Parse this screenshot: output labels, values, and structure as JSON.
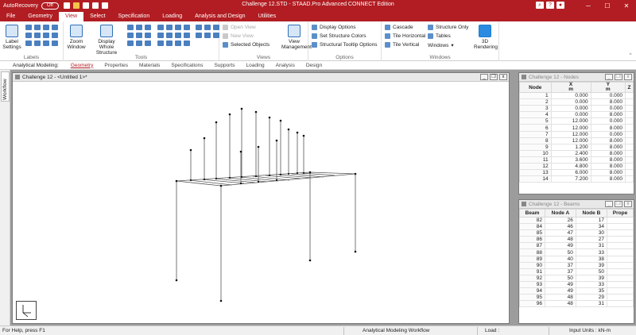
{
  "titlebar": {
    "autorecovery": "AutoRecovery",
    "autorecovery_state": "Off",
    "title": "Challenge 12.STD - STAAD.Pro Advanced CONNECT Edition",
    "minimize": "─",
    "maximize": "☐",
    "close": "✕"
  },
  "menu": {
    "tabs": [
      "File",
      "Geometry",
      "View",
      "Select",
      "Specification",
      "Loading",
      "Analysis and Design",
      "Utilities"
    ],
    "active": "View"
  },
  "ribbon": {
    "labels_group": {
      "name": "Labels",
      "label_settings": "Label Settings"
    },
    "tools_group": {
      "name": "Tools",
      "zoom_window": "Zoom Window",
      "display_whole": "Display Whole Structure"
    },
    "views_group": {
      "name": "Views",
      "open_view": "Open View",
      "new_view": "New View",
      "selected_objects": "Selected Objects",
      "view_management": "View Management"
    },
    "options_group": {
      "name": "Options",
      "display_options": "Display Options",
      "set_structure_colors": "Set Structure Colors",
      "structural_tooltip": "Structural Tooltip Options"
    },
    "windows_group": {
      "name": "Windows",
      "cascade": "Cascade",
      "tile_horizontal": "Tile Horizontal",
      "tile_vertical": "Tile Vertical",
      "structure_only": "Structure Only",
      "tables": "Tables",
      "windows": "Windows",
      "rendering_3d": "3D Rendering"
    }
  },
  "subbar": {
    "label": "Analytical Modeling:",
    "items": [
      "Geometry",
      "Properties",
      "Materials",
      "Specifications",
      "Supports",
      "Loading",
      "Analysis",
      "Design"
    ],
    "active": "Geometry"
  },
  "workflow_tab": "Workflow",
  "main_window": {
    "title": "Challenge 12 - <Untitled 1>*"
  },
  "nodes_window": {
    "title": "Challenge 12 - Nodes",
    "headers": [
      "Node",
      "X\nm",
      "Y\nm",
      "Z"
    ],
    "rows": [
      [
        "1",
        "0.000",
        "0.000"
      ],
      [
        "2",
        "0.000",
        "8.000"
      ],
      [
        "3",
        "0.000",
        "0.000"
      ],
      [
        "4",
        "0.000",
        "8.000"
      ],
      [
        "5",
        "12.000",
        "0.000"
      ],
      [
        "6",
        "12.000",
        "8.000"
      ],
      [
        "7",
        "12.000",
        "0.000"
      ],
      [
        "8",
        "12.000",
        "8.000"
      ],
      [
        "9",
        "1.200",
        "8.000"
      ],
      [
        "10",
        "2.400",
        "8.000"
      ],
      [
        "11",
        "3.600",
        "8.000"
      ],
      [
        "12",
        "4.800",
        "8.000"
      ],
      [
        "13",
        "6.000",
        "8.000"
      ],
      [
        "14",
        "7.200",
        "8.000"
      ]
    ]
  },
  "beams_window": {
    "title": "Challenge 12 - Beams",
    "headers": [
      "Beam",
      "Node A",
      "Node B",
      "Prope"
    ],
    "rows": [
      [
        "82",
        "26",
        "17"
      ],
      [
        "84",
        "46",
        "34"
      ],
      [
        "85",
        "47",
        "30"
      ],
      [
        "86",
        "48",
        "27"
      ],
      [
        "87",
        "49",
        "31"
      ],
      [
        "88",
        "50",
        "33"
      ],
      [
        "89",
        "40",
        "38"
      ],
      [
        "90",
        "37",
        "39"
      ],
      [
        "91",
        "37",
        "50"
      ],
      [
        "92",
        "50",
        "39"
      ],
      [
        "93",
        "49",
        "33"
      ],
      [
        "94",
        "49",
        "35"
      ],
      [
        "95",
        "48",
        "29"
      ],
      [
        "96",
        "48",
        "31"
      ]
    ]
  },
  "status": {
    "help": "For Help, press F1",
    "workflow": "Analytical Modeling Workflow",
    "load": "Load :",
    "units": "Input Units : kN-m"
  },
  "colors": {
    "accent": "#b11d22",
    "mdi_background": "#9c9c9c"
  }
}
